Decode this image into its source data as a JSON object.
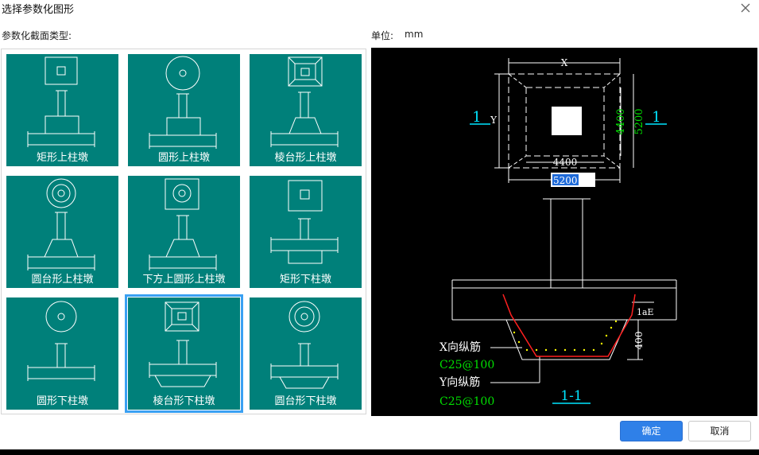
{
  "dialog": {
    "title": "选择参数化图形"
  },
  "labels": {
    "section_type": "参数化截面类型:",
    "unit_label": "单位:",
    "unit_value": "mm"
  },
  "tiles": [
    {
      "label": "矩形上柱墩",
      "selected": false
    },
    {
      "label": "圆形上柱墩",
      "selected": false
    },
    {
      "label": "棱台形上柱墩",
      "selected": false
    },
    {
      "label": "圆台形上柱墩",
      "selected": false
    },
    {
      "label": "下方上圆形上柱墩",
      "selected": false
    },
    {
      "label": "矩形下柱墩",
      "selected": false
    },
    {
      "label": "圆形下柱墩",
      "selected": false
    },
    {
      "label": "棱台形下柱墩",
      "selected": true
    },
    {
      "label": "圆台形下柱墩",
      "selected": false
    }
  ],
  "preview": {
    "x_label": "X",
    "y_label": "Y",
    "dim_inner_h": "4400",
    "dim_inner_v": "4400",
    "dim_outer_v": "5200",
    "dim_outer_h_input": "5200",
    "section_mark_left": "1",
    "section_mark_right": "1",
    "lae_label": "1aE",
    "depth_dim": "400",
    "x_rebar_label": "X向纵筋",
    "x_rebar_value": "C25@100",
    "y_rebar_label": "Y向纵筋",
    "y_rebar_value": "C25@100",
    "section_title": "1-1"
  },
  "buttons": {
    "ok": "确定",
    "cancel": "取消"
  },
  "colors": {
    "tile_bg": "#00807a",
    "selection": "#3aa0f2",
    "primary": "#2f80e8",
    "cad_green": "#00e000",
    "cad_cyan": "#00e5ff",
    "cad_red": "#ff2020",
    "cad_yellow": "#ffff00"
  }
}
